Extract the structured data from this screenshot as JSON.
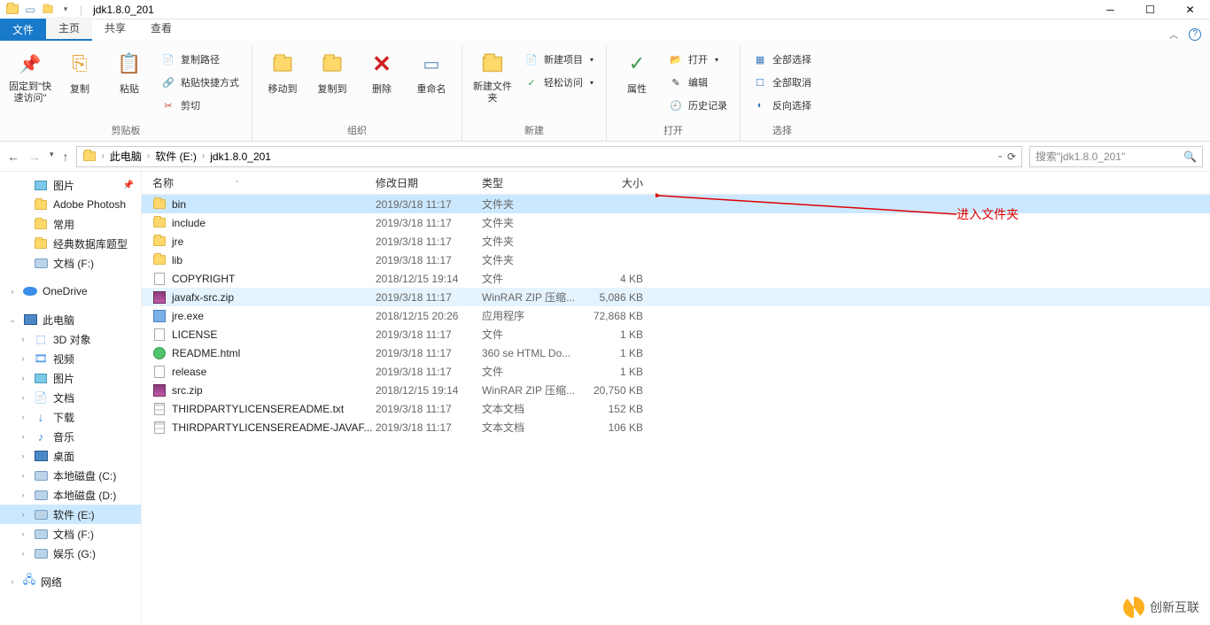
{
  "title": "jdk1.8.0_201",
  "tabs": {
    "file": "文件",
    "home": "主页",
    "share": "共享",
    "view": "查看"
  },
  "ribbon": {
    "pin": "固定到\"快速访问\"",
    "copy": "复制",
    "paste": "粘贴",
    "copypath": "复制路径",
    "pasteshortcut": "粘贴快捷方式",
    "cut": "剪切",
    "clipboard": "剪贴板",
    "moveto": "移动到",
    "copyto": "复制到",
    "delete": "删除",
    "rename": "重命名",
    "organize": "组织",
    "newfolder": "新建文件夹",
    "newitem": "新建项目",
    "easyaccess": "轻松访问",
    "new": "新建",
    "properties": "属性",
    "open": "打开",
    "edit": "编辑",
    "history": "历史记录",
    "opengrp": "打开",
    "selectall": "全部选择",
    "selectnone": "全部取消",
    "invert": "反向选择",
    "select": "选择"
  },
  "breadcrumb": {
    "thispc": "此电脑",
    "drive": "软件 (E:)",
    "folder": "jdk1.8.0_201"
  },
  "search_placeholder": "搜索\"jdk1.8.0_201\"",
  "columns": {
    "name": "名称",
    "date": "修改日期",
    "type": "类型",
    "size": "大小"
  },
  "sidebar": {
    "pictures": "图片",
    "adobe": "Adobe Photosh",
    "common": "常用",
    "dbmodel": "经典数据库题型",
    "docs_f": "文档 (F:)",
    "onedrive": "OneDrive",
    "thispc": "此电脑",
    "obj3d": "3D 对象",
    "videos": "视频",
    "pictures2": "图片",
    "docs": "文档",
    "downloads": "下载",
    "music": "音乐",
    "desktop": "桌面",
    "drive_c": "本地磁盘 (C:)",
    "drive_d": "本地磁盘 (D:)",
    "drive_e": "软件 (E:)",
    "docs_f2": "文档 (F:)",
    "ent_g": "娱乐 (G:)",
    "network": "网络"
  },
  "files": [
    {
      "name": "bin",
      "date": "2019/3/18 11:17",
      "type": "文件夹",
      "size": "",
      "icon": "folder",
      "sel": true
    },
    {
      "name": "include",
      "date": "2019/3/18 11:17",
      "type": "文件夹",
      "size": "",
      "icon": "folder"
    },
    {
      "name": "jre",
      "date": "2019/3/18 11:17",
      "type": "文件夹",
      "size": "",
      "icon": "folder"
    },
    {
      "name": "lib",
      "date": "2019/3/18 11:17",
      "type": "文件夹",
      "size": "",
      "icon": "folder"
    },
    {
      "name": "COPYRIGHT",
      "date": "2018/12/15 19:14",
      "type": "文件",
      "size": "4 KB",
      "icon": "file"
    },
    {
      "name": "javafx-src.zip",
      "date": "2019/3/18 11:17",
      "type": "WinRAR ZIP 压缩...",
      "size": "5,086 KB",
      "icon": "zip",
      "hov": true
    },
    {
      "name": "jre.exe",
      "date": "2018/12/15 20:26",
      "type": "应用程序",
      "size": "72,868 KB",
      "icon": "exe"
    },
    {
      "name": "LICENSE",
      "date": "2019/3/18 11:17",
      "type": "文件",
      "size": "1 KB",
      "icon": "file"
    },
    {
      "name": "README.html",
      "date": "2019/3/18 11:17",
      "type": "360 se HTML Do...",
      "size": "1 KB",
      "icon": "html"
    },
    {
      "name": "release",
      "date": "2019/3/18 11:17",
      "type": "文件",
      "size": "1 KB",
      "icon": "file"
    },
    {
      "name": "src.zip",
      "date": "2018/12/15 19:14",
      "type": "WinRAR ZIP 压缩...",
      "size": "20,750 KB",
      "icon": "zip"
    },
    {
      "name": "THIRDPARTYLICENSEREADME.txt",
      "date": "2019/3/18 11:17",
      "type": "文本文档",
      "size": "152 KB",
      "icon": "txt"
    },
    {
      "name": "THIRDPARTYLICENSEREADME-JAVAF...",
      "date": "2019/3/18 11:17",
      "type": "文本文档",
      "size": "106 KB",
      "icon": "txt"
    }
  ],
  "annotation": "进入文件夹",
  "watermark": "创新互联"
}
